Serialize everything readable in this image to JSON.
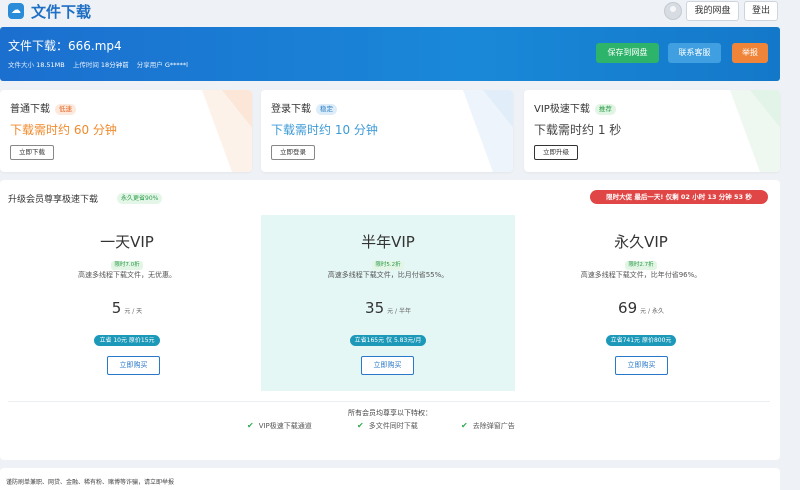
{
  "header": {
    "site_title": "文件下载",
    "my_drive_label": "我的网盘",
    "logout_label": "登出"
  },
  "banner": {
    "file_title": "文件下载：666.mp4",
    "size_label": "文件大小",
    "size_value": "18.51MB",
    "upload_label": "上传时间",
    "upload_value": "18分钟前",
    "share_label": "分享用户",
    "share_value": "G*****l",
    "save_btn": "保存到网盘",
    "service_btn": "联系客服",
    "report_btn": "举报",
    "colors": {
      "save": "#2db36a",
      "service": "#3f9fe0",
      "report": "#f0853a"
    }
  },
  "plans": [
    {
      "title": "普通下载",
      "tag": "低速",
      "time": "下载需时约 60 分钟",
      "button": "立即下载",
      "time_color": "#f08a2c",
      "tag_bg": "#fde8dc",
      "tag_color": "#e36a2a"
    },
    {
      "title": "登录下载",
      "tag": "稳定",
      "time": "下载需时约 10 分钟",
      "button": "立即登录",
      "time_color": "#3c9ad6",
      "tag_bg": "#dcecf9",
      "tag_color": "#2f7fc4"
    },
    {
      "title": "VIP极速下载",
      "tag": "推荐",
      "time": "下载需时约 1 秒",
      "button": "立即升级",
      "time_color": "#444444",
      "tag_bg": "#e0f5e4",
      "tag_color": "#2d9d4a"
    }
  ],
  "upgrade": {
    "title": "升级会员尊享极速下载",
    "badge": "永久更省90%",
    "countdown": "限时大促 最后一天! 仅剩 02 小时 13 分钟 53 秒",
    "tiers": [
      {
        "name": "一天VIP",
        "discount": "限时7.0折",
        "desc": "高速多线程下载文件，无优惠。",
        "price": "5",
        "unit": "元 / 天",
        "save": "立省 10元 原价15元",
        "buy": "立即购买"
      },
      {
        "name": "半年VIP",
        "discount": "限时5.2折",
        "desc": "高速多线程下载文件，比月付省55%。",
        "price": "35",
        "unit": "元 / 半年",
        "save": "立省165元 仅 5.83元/月",
        "buy": "立即购买"
      },
      {
        "name": "永久VIP",
        "discount": "限时2.7折",
        "desc": "高速多线程下载文件，比年付省96%。",
        "price": "69",
        "unit": "元 / 永久",
        "save": "立省741元 原价800元",
        "buy": "立即购买"
      }
    ],
    "privileges_title": "所有会员均尊享以下特权：",
    "privileges": [
      "VIP极速下载通道",
      "多文件同时下载",
      "去除弹窗广告"
    ]
  },
  "footer": {
    "notice": "谨防刷单兼职、网贷、金融、稀有粉、赌博等诈骗，请立即举报"
  }
}
